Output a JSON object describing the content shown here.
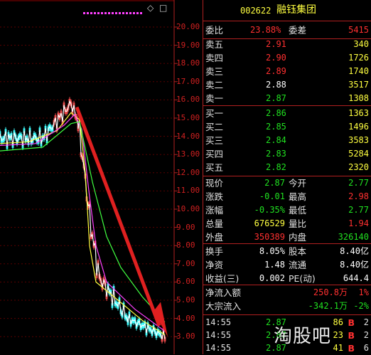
{
  "chart": {
    "toolbar": "◇ □",
    "y_labels": [
      "20.00",
      "19.00",
      "18.00",
      "17.00",
      "16.00",
      "15.00",
      "14.00",
      "13.00",
      "12.00",
      "11.00",
      "10.00",
      "9.00",
      "8.00",
      "7.00",
      "6.00",
      "5.00",
      "4.00",
      "3.00"
    ],
    "colors": {
      "price": "#ffffff",
      "ma_yellow": "#ffff40",
      "ma_magenta": "#ff40ff",
      "ma_green": "#40ff40",
      "arrow": "#e02020",
      "grid": "#8b0000"
    }
  },
  "header": {
    "code": "002622",
    "name": "融钰集团"
  },
  "commission": {
    "ratio_label": "委比",
    "ratio": "23.88%",
    "diff_label": "委差",
    "diff": "5415"
  },
  "asks": [
    {
      "label": "卖五",
      "price": "2.91",
      "vol": "340"
    },
    {
      "label": "卖四",
      "price": "2.90",
      "vol": "1726"
    },
    {
      "label": "卖三",
      "price": "2.89",
      "vol": "1740"
    },
    {
      "label": "卖二",
      "price": "2.88",
      "vol": "3517"
    },
    {
      "label": "卖一",
      "price": "2.87",
      "vol": "1308"
    }
  ],
  "bids": [
    {
      "label": "买一",
      "price": "2.86",
      "vol": "1363"
    },
    {
      "label": "买二",
      "price": "2.85",
      "vol": "1496"
    },
    {
      "label": "买三",
      "price": "2.84",
      "vol": "3583"
    },
    {
      "label": "买四",
      "price": "2.83",
      "vol": "5284"
    },
    {
      "label": "买五",
      "price": "2.82",
      "vol": "2320"
    }
  ],
  "quote": [
    {
      "l1": "现价",
      "v1": "2.87",
      "l2": "今开",
      "v2": "2.77"
    },
    {
      "l1": "涨跌",
      "v1": "-0.01",
      "l2": "最高",
      "v2": "2.98"
    },
    {
      "l1": "涨幅",
      "v1": "-0.35%",
      "l2": "最低",
      "v2": "2.77"
    },
    {
      "l1": "总量",
      "v1": "676529",
      "l2": "量比",
      "v2": "1.94"
    },
    {
      "l1": "外盘",
      "v1": "350389",
      "l2": "内盘",
      "v2": "326140"
    }
  ],
  "stats": [
    {
      "l1": "换手",
      "v1": "8.05%",
      "l2": "股本",
      "v2": "8.40亿"
    },
    {
      "l1": "净资",
      "v1": "1.48",
      "l2": "流通",
      "v2": "8.40亿"
    },
    {
      "l1": "收益(三)",
      "v1": "0.002",
      "l2": "PE(动)",
      "v2": "644.4"
    }
  ],
  "flows": [
    {
      "label": "净流入额",
      "value": "250.8万",
      "pct": "1%"
    },
    {
      "label": "大宗流入",
      "value": "-342.1万",
      "pct": "-2%"
    }
  ],
  "ticks": [
    {
      "time": "14:55",
      "price": "2.87",
      "vol": "86",
      "flag": "B",
      "n": "2"
    },
    {
      "time": "14:55",
      "price": "2.87",
      "vol": "23",
      "flag": "B",
      "n": "2"
    },
    {
      "time": "14:55",
      "price": "2.87",
      "vol": "41",
      "flag": "B",
      "n": "6"
    }
  ],
  "watermark": "淘股吧"
}
